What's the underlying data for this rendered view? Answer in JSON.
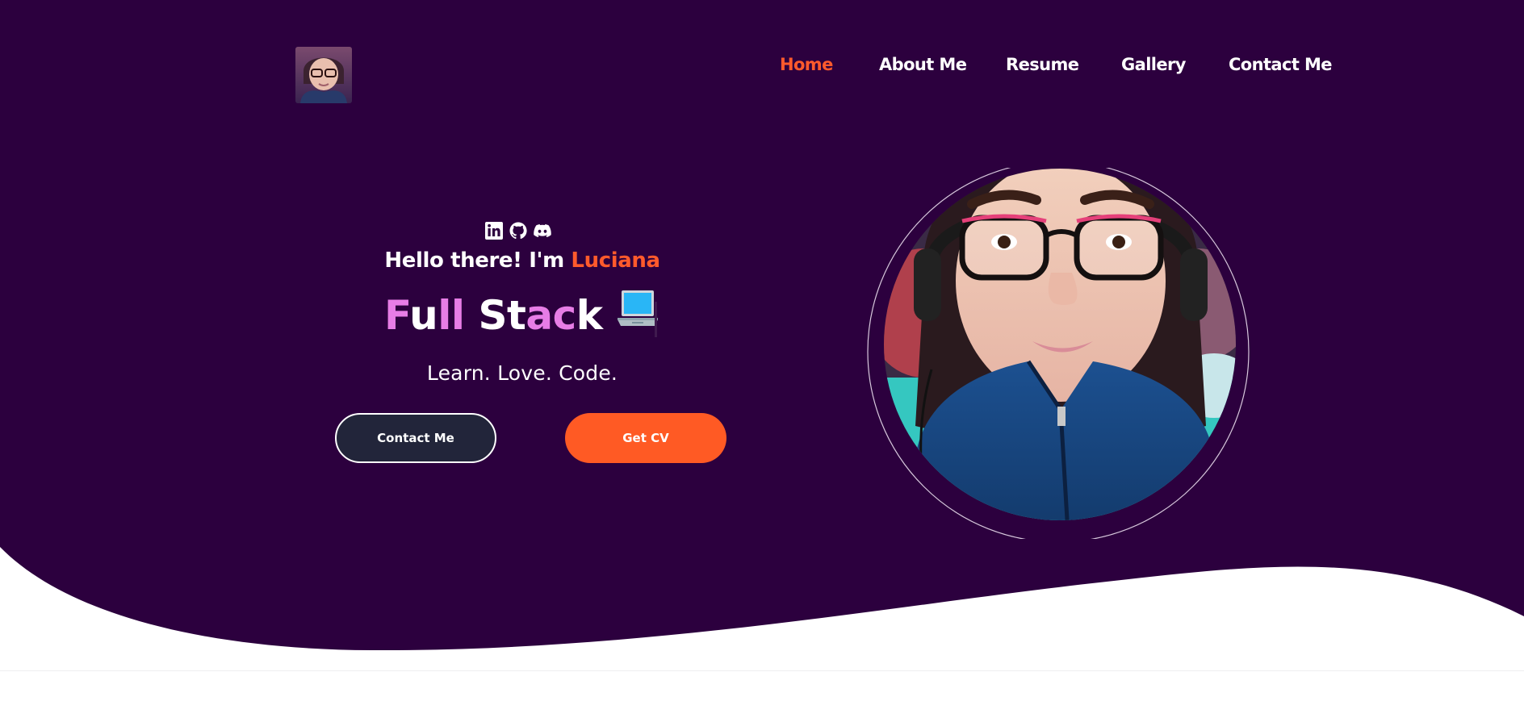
{
  "theme": {
    "hero_bg": "#2c003e",
    "accent": "#ff5a2c",
    "role_highlight": "#e77de6",
    "contact_button_bg": "#22253a",
    "cv_button_bg": "#ff5a24"
  },
  "nav": {
    "logo_alt": "Luciana avatar",
    "items": [
      {
        "label": "Home",
        "active": true
      },
      {
        "label": "About Me"
      },
      {
        "label": "Resume"
      },
      {
        "label": "Gallery"
      },
      {
        "label": "Contact Me"
      }
    ]
  },
  "hero": {
    "social_icons": [
      "linkedin-icon",
      "github-icon",
      "discord-icon"
    ],
    "greeting_prefix": "Hello there! I'm",
    "greeting_name": "Luciana",
    "role_text": "Full Stack",
    "role_emoji": "laptop-icon",
    "tagline": "Learn. Love. Code.",
    "contact_button": "Contact Me",
    "cv_button": "Get CV",
    "portrait_alt": "Portrait of Luciana"
  }
}
